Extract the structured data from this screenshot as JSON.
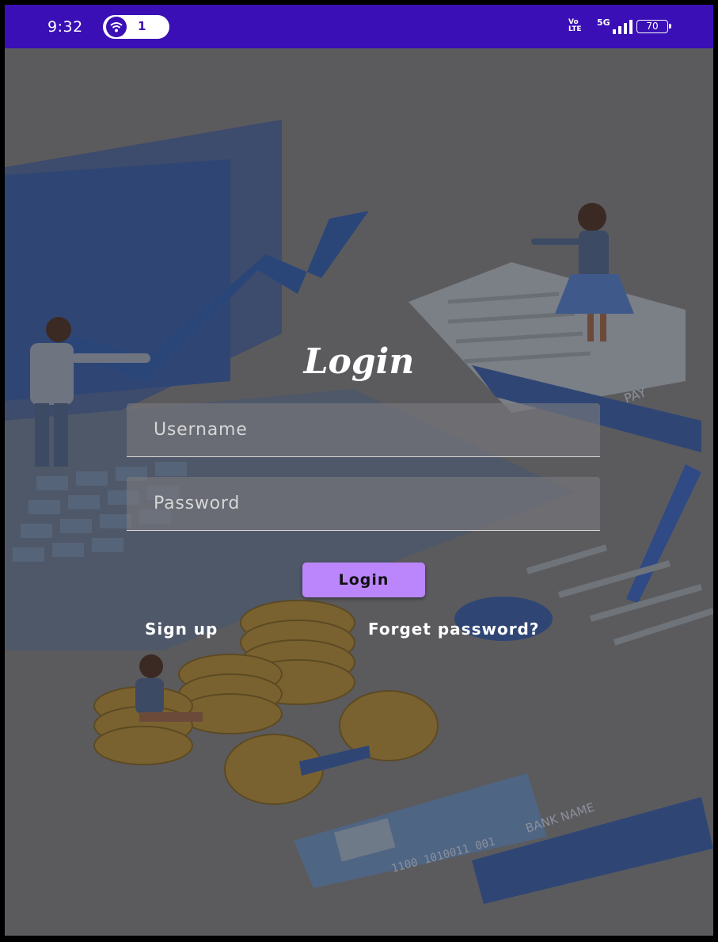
{
  "status_bar": {
    "time": "9:32",
    "hotspot_count": "1",
    "volte": "Vo\nLTE",
    "network": "5G",
    "battery": "70"
  },
  "login": {
    "title": "Login",
    "username_placeholder": "Username",
    "password_placeholder": "Password",
    "login_button": "Login",
    "signup_link": "Sign up",
    "forget_link": "Forget password?"
  },
  "background": {
    "card_text_1": "PAY",
    "card_text_2": "BANK NAME",
    "card_number": "1100 1010011 001"
  },
  "colors": {
    "status_bar": "#3a0fb5",
    "accent": "#bb86fc",
    "overlay": "#5b5b5e"
  }
}
